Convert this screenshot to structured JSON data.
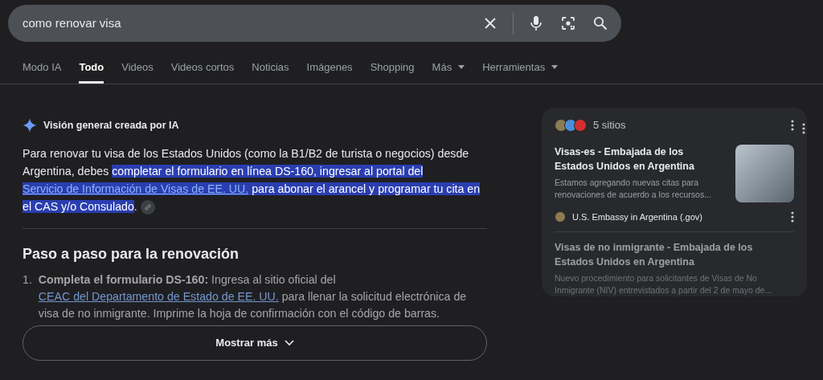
{
  "search": {
    "value": "como renovar visa"
  },
  "tabs": [
    {
      "label": "Modo IA",
      "selected": false,
      "dropdown": false
    },
    {
      "label": "Todo",
      "selected": true,
      "dropdown": false
    },
    {
      "label": "Videos",
      "selected": false,
      "dropdown": false
    },
    {
      "label": "Videos cortos",
      "selected": false,
      "dropdown": false
    },
    {
      "label": "Noticias",
      "selected": false,
      "dropdown": false
    },
    {
      "label": "Imágenes",
      "selected": false,
      "dropdown": false
    },
    {
      "label": "Shopping",
      "selected": false,
      "dropdown": false
    },
    {
      "label": "Más",
      "selected": false,
      "dropdown": true
    },
    {
      "label": "Herramientas",
      "selected": false,
      "dropdown": true
    }
  ],
  "overview": {
    "title": "Visión general creada por IA",
    "paragraph": [
      {
        "text": "Para renovar tu visa de los Estados Unidos (como la B1/B2 de turista o negocios) desde Argentina, debes ",
        "highlighted": false,
        "link": false
      },
      {
        "text": "completar el formulario en línea DS-160, ingresar al portal del ",
        "highlighted": true,
        "link": false
      },
      {
        "text": "Servicio de Información de Visas de EE. UU.",
        "highlighted": true,
        "link": true
      },
      {
        "text": " para abonar el arancel y programar tu cita en el CAS y/o Consulado",
        "highlighted": true,
        "link": false
      },
      {
        "text": ".",
        "highlighted": false,
        "link": false
      }
    ],
    "heading": "Paso a paso para la renovación",
    "steps": [
      {
        "number": "1.",
        "segments": [
          {
            "text": "**Completa el formulario DS-160:** Ingresa al sitio oficial del ",
            "link": false
          },
          {
            "text": "CEAC del Departamento de Estado de EE. UU.",
            "link": true
          },
          {
            "text": " para llenar la solicitud electrónica de visa de no inmigrante. Imprime la hoja de confirmación con el código de barras.",
            "link": false
          }
        ]
      }
    ],
    "show_more": "Mostrar más"
  },
  "sources": {
    "count": "5 sitios",
    "items": [
      {
        "title": "Visas-es - Embajada de los Estados Unidos en Argentina",
        "snippet": "Estamos agregando nuevas citas para renovaciones de acuerdo a los recursos...",
        "site": "U.S. Embassy in Argentina (.gov)",
        "thumbnail": true
      },
      {
        "title": "Visas de no inmigrante - Embajada de los Estados Unidos en Argentina",
        "snippet": "Nuevo procedimiento para solicitantes de Visas de No Inmigrante (NIV) entrevistados a partir del 2 de mayo de...",
        "thumbnail": false
      }
    ]
  }
}
